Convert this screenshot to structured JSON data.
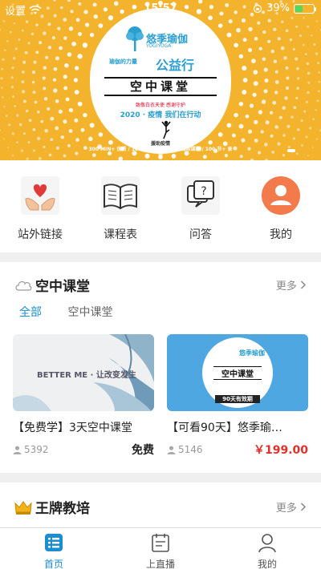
{
  "status_bar": {
    "carrier": "设置",
    "time": "15:57",
    "battery_text": "39%",
    "battery_level": 0.39
  },
  "banner": {
    "brand": "悠季瑜伽",
    "brand_sub": "YOGIYOGA",
    "power_text": "瑜伽的力量",
    "public_welfare": "公益行",
    "stage": "空中课堂",
    "slogan_small": "致敬白衣天使 感谢守护",
    "slogan": "2020 · 疫情  我们在行动",
    "help": "援助疫情",
    "stats": "300 MIN+ 优质 / 100 节+ 直播 / 10+ 国际课程 / 100 节+ 录音",
    "pager_active": 0,
    "pager_count": 2
  },
  "quick_nav": [
    {
      "icon": "heart-hands-icon",
      "label": "站外链接"
    },
    {
      "icon": "book-icon",
      "label": "课程表"
    },
    {
      "icon": "qa-bubble-icon",
      "label": "问答"
    },
    {
      "icon": "user-avatar-icon",
      "label": "我的"
    }
  ],
  "classroom": {
    "title": "空中课堂",
    "more": "更多",
    "tabs": [
      {
        "label": "全部",
        "active": true
      },
      {
        "label": "空中课堂",
        "active": false
      }
    ],
    "cards": [
      {
        "image_text": "BETTER ME · 让改变发生",
        "title": "【免费学】3天空中课堂",
        "count": "5392",
        "price": "免费"
      },
      {
        "image_text": "空中课堂",
        "image_sub": "90天有效期",
        "image_brand": "悠季瑜伽",
        "title": "【可看90天】悠季瑜…",
        "count": "5146",
        "price": "￥199.00"
      }
    ]
  },
  "trainer": {
    "title": "王牌教培",
    "more": "更多"
  },
  "tabbar": [
    {
      "icon": "home-list-icon",
      "label": "首页",
      "active": true
    },
    {
      "icon": "live-board-icon",
      "label": "上直播",
      "active": false
    },
    {
      "icon": "profile-icon",
      "label": "我的",
      "active": false
    }
  ],
  "colors": {
    "accent": "#1a8ed0",
    "banner_bg": "#f3b32d",
    "price_red": "#e0302b"
  }
}
